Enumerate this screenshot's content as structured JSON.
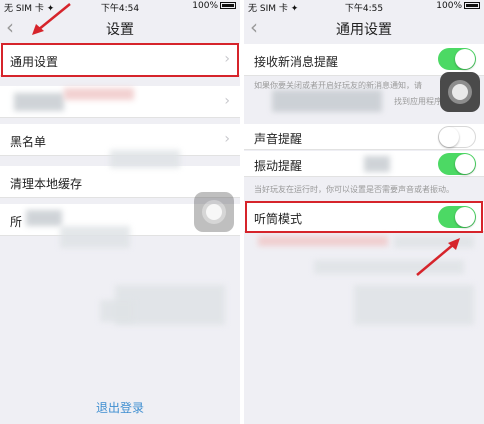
{
  "left": {
    "status": {
      "carrier": "无 SIM 卡 ✦",
      "time": "下午4:54",
      "battery": "100%"
    },
    "nav": {
      "back": "‹",
      "title": "设置"
    },
    "rows": {
      "general": "通用设置",
      "blacklist": "黑名单",
      "clear_cache": "清理本地缓存",
      "partial": "所"
    },
    "chevron": "›",
    "logout": "退出登录"
  },
  "right": {
    "status": {
      "carrier": "无 SIM 卡 ✦",
      "time": "下午4:55",
      "battery": "100%"
    },
    "nav": {
      "back": "‹",
      "title": "通用设置"
    },
    "rows": {
      "new_msg": "接收新消息提醒",
      "sound": "声音提醒",
      "vibrate": "振动提醒",
      "earpiece": "听筒模式"
    },
    "hint1a": "如果你要关闭或者开启好玩友的新消息通知，请",
    "hint1b": "找到应用程序",
    "hint2": "当好玩友在运行时，你可以设置是否需要声音或者振动。",
    "toggles": {
      "new_msg": "on",
      "sound": "off",
      "vibrate": "on",
      "earpiece": "on"
    }
  },
  "colors": {
    "highlight": "#d6242b",
    "toggle_on": "#4cd964",
    "link": "#3e8ed0"
  }
}
